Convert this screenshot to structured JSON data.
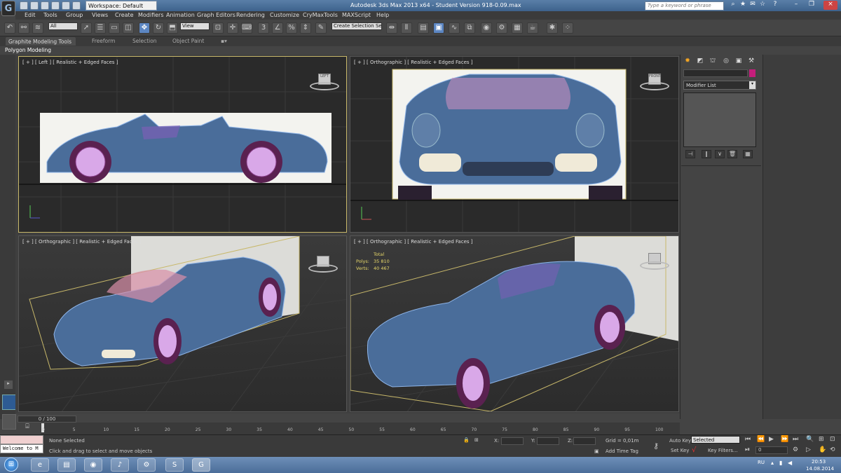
{
  "titlebar": {
    "app_title": "Autodesk 3ds Max  2013 x64     - Student Version    918-0.09.max",
    "workspace": "Workspace: Default",
    "search_placeholder": "Type a keyword or phrase"
  },
  "menubar": [
    "Edit",
    "Tools",
    "Group",
    "Views",
    "Create",
    "Modifiers",
    "Animation",
    "Graph Editors",
    "Rendering",
    "Customize",
    "CryMaxTools",
    "MAXScript",
    "Help"
  ],
  "toolbar": {
    "selection_filter": "All",
    "reference_coord": "View",
    "named_selection": "Create Selection Se",
    "snap_label": "3"
  },
  "ribbon": {
    "tabs": [
      "Graphite Modeling Tools",
      "Freeform",
      "Selection",
      "Object Paint"
    ],
    "panel_label": "Polygon Modeling"
  },
  "viewports": {
    "top_left": "[ + ] [ Left ] [ Realistic + Edged Faces ]",
    "top_right": "[ + ] [ Orthographic ] [ Realistic + Edged Faces ]",
    "bottom_left": "[ + ] [ Orthographic ] [ Realistic + Edged Faces ]",
    "bottom_right": "[ + ] [ Orthographic ] [ Realistic + Edged Faces ]",
    "stats": {
      "total_label": "Total",
      "polys_label": "Polys:",
      "polys_value": "35 810",
      "verts_label": "Verts:",
      "verts_value": "40 467"
    }
  },
  "command_panel": {
    "modifier_list": "Modifier List"
  },
  "timeline": {
    "frame_display": "0 / 100",
    "ticks": [
      "0",
      "5",
      "10",
      "15",
      "20",
      "25",
      "30",
      "35",
      "40",
      "45",
      "50",
      "55",
      "60",
      "65",
      "70",
      "75",
      "80",
      "85",
      "90",
      "95",
      "100"
    ]
  },
  "statusbar": {
    "welcome": "Welcome to M",
    "selection_status": "None Selected",
    "prompt": "Click and drag to select and move objects",
    "x_label": "X:",
    "y_label": "Y:",
    "z_label": "Z:",
    "grid": "Grid = 0,01m",
    "add_time_tag": "Add Time Tag",
    "auto_key": "Auto Key",
    "auto_key_value": "Selected",
    "set_key": "Set Key",
    "key_filters": "Key Filters...",
    "frame_value": "0"
  },
  "taskbar": {
    "language": "RU",
    "time": "20:53",
    "date": "14.08.2014"
  },
  "colors": {
    "accent_blue": "#5c86c2",
    "active_viewport": "#c8b86a",
    "color_swatch": "#c41d7b"
  }
}
